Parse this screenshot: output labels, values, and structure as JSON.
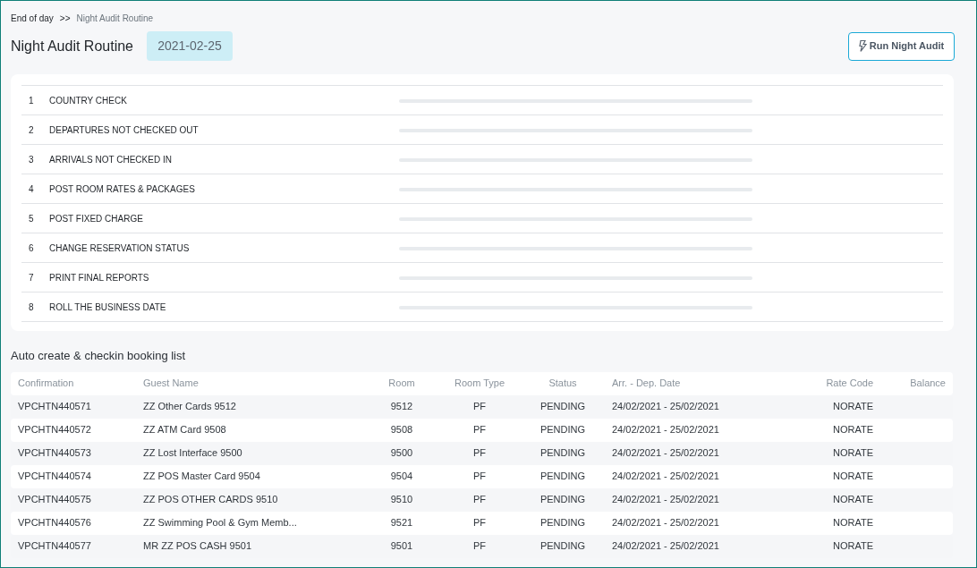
{
  "breadcrumb": [
    {
      "label": "End of day",
      "current": false
    },
    {
      "label": ">>",
      "current": false
    },
    {
      "label": "Night Audit Routine",
      "current": true
    }
  ],
  "title": "Night Audit Routine",
  "business_date": "2021-02-25",
  "run_button": {
    "label": "Run Night Audit"
  },
  "steps": [
    {
      "number": "1",
      "label": "COUNTRY CHECK",
      "level": 0
    },
    {
      "number": "2",
      "label": "DEPARTURES NOT CHECKED OUT",
      "level": 0
    },
    {
      "number": "3",
      "label": "ARRIVALS NOT CHECKED IN",
      "level": 0
    },
    {
      "number": "4",
      "label": "POST ROOM RATES & PACKAGES",
      "level": 0
    },
    {
      "number": "5",
      "label": "POST FIXED CHARGE",
      "level": 0
    },
    {
      "number": "6",
      "label": "CHANGE RESERVATION STATUS",
      "level": 0
    },
    {
      "number": "7",
      "label": "PRINT FINAL REPORTS",
      "level": 0
    },
    {
      "number": "8",
      "label": "ROLL THE BUSINESS DATE",
      "level": 0
    }
  ],
  "booking_list": {
    "title": "Auto create & checkin booking list",
    "columns": [
      "Confirmation",
      "Guest Name",
      "Room",
      "Room Type",
      "Status",
      "Arr. - Dep. Date",
      "Rate Code",
      "Balance"
    ],
    "rows": [
      [
        "VPCHTN440571",
        "ZZ Other Cards 9512",
        "9512",
        "PF",
        "PENDING",
        "24/02/2021 - 25/02/2021",
        "NORATE"
      ],
      [
        "VPCHTN440572",
        "ZZ ATM Card 9508",
        "9508",
        "PF",
        "PENDING",
        "24/02/2021 - 25/02/2021",
        "NORATE"
      ],
      [
        "VPCHTN440573",
        "ZZ Lost Interface 9500",
        "9500",
        "PF",
        "PENDING",
        "24/02/2021 - 25/02/2021",
        "NORATE"
      ],
      [
        "VPCHTN440574",
        "ZZ POS Master Card 9504",
        "9504",
        "PF",
        "PENDING",
        "24/02/2021 - 25/02/2021",
        "NORATE"
      ],
      [
        "VPCHTN440575",
        "ZZ POS OTHER CARDS 9510",
        "9510",
        "PF",
        "PENDING",
        "24/02/2021 - 25/02/2021",
        "NORATE"
      ],
      [
        "VPCHTN440576",
        "ZZ Swimming Pool & Gym Memb...",
        "9521",
        "PF",
        "PENDING",
        "24/02/2021 - 25/02/2021",
        "NORATE"
      ],
      [
        "VPCHTN440577",
        "MR ZZ POS CASH 9501",
        "9501",
        "PF",
        "PENDING",
        "24/02/2021 - 25/02/2021",
        "NORATE"
      ]
    ]
  }
}
